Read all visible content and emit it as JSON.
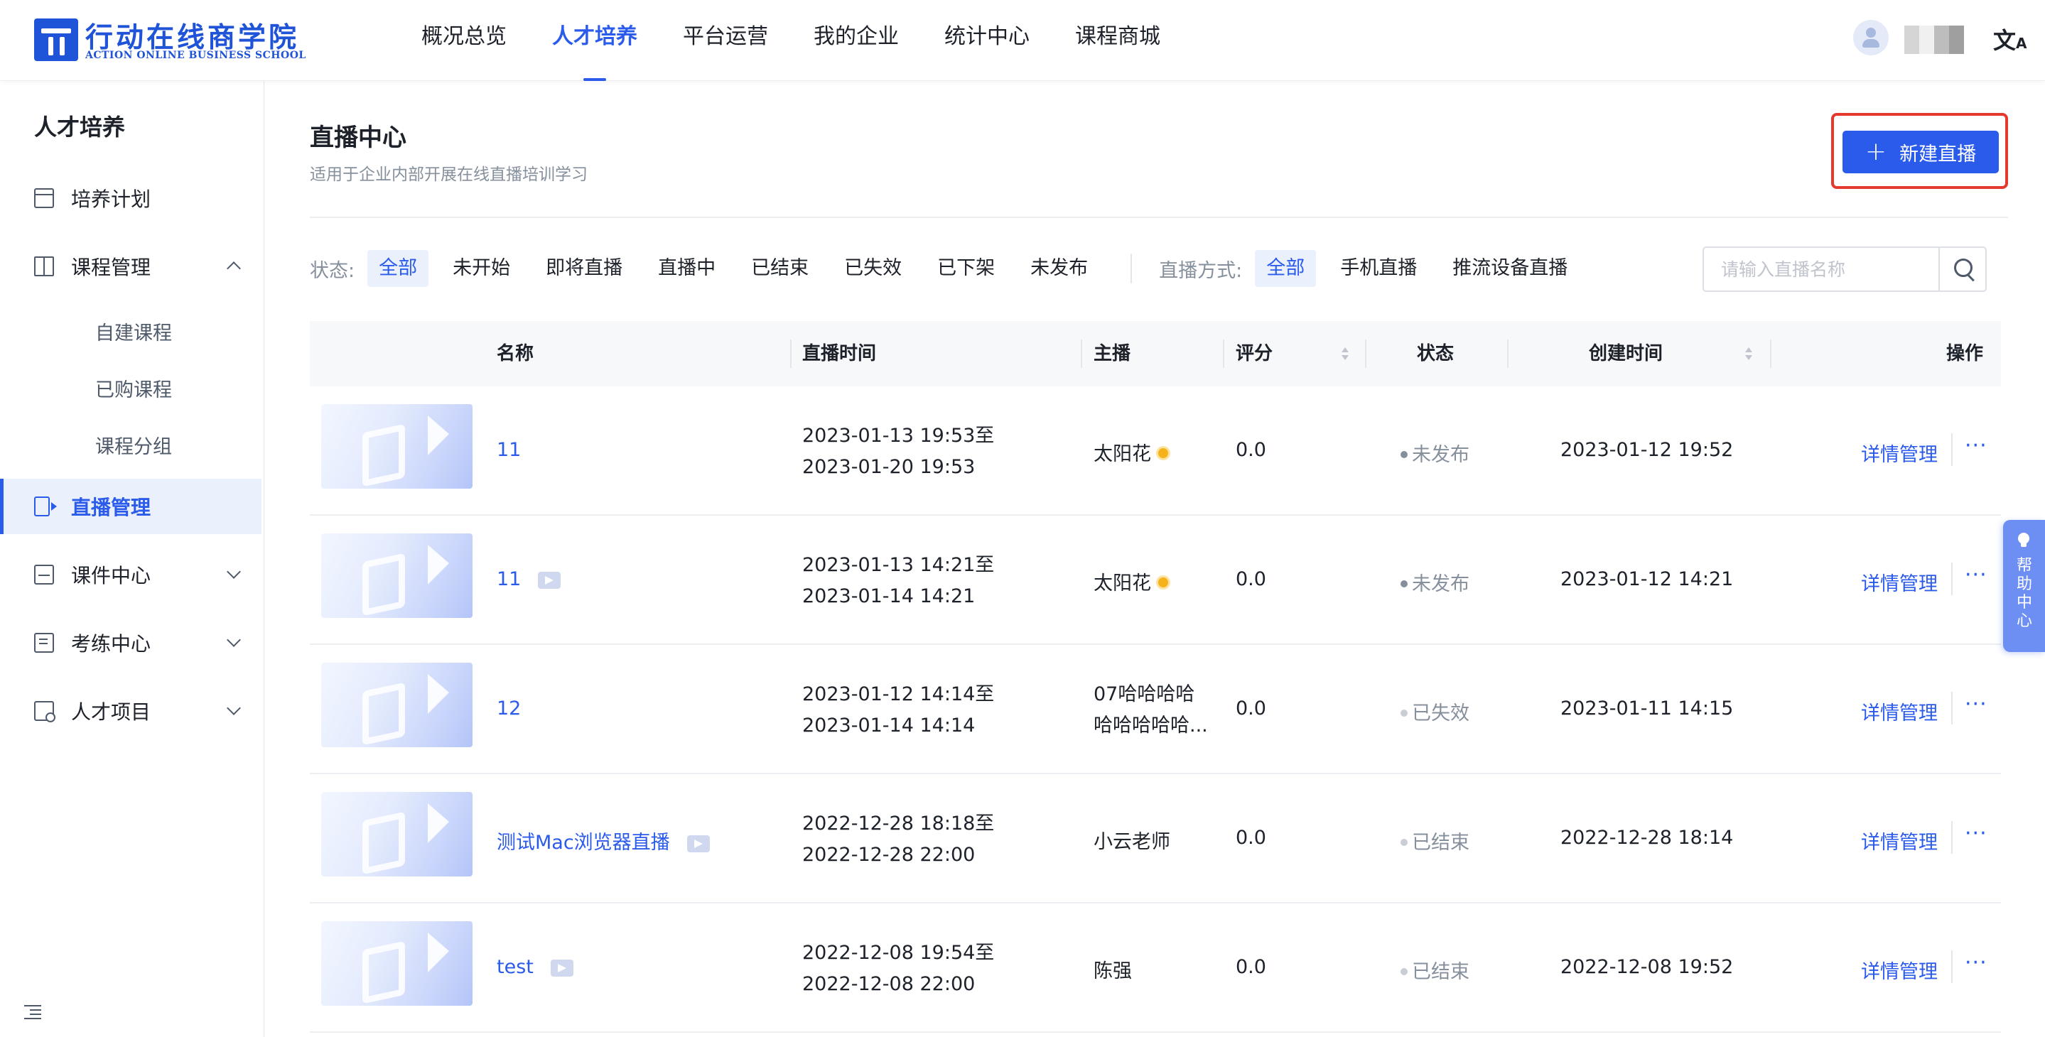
{
  "header": {
    "logo_cn": "行动在线商学院",
    "logo_en": "ACTION ONLINE BUSINESS SCHOOL",
    "nav": [
      {
        "label": "概况总览",
        "active": false
      },
      {
        "label": "人才培养",
        "active": true
      },
      {
        "label": "平台运营",
        "active": false
      },
      {
        "label": "我的企业",
        "active": false
      },
      {
        "label": "统计中心",
        "active": false
      },
      {
        "label": "课程商城",
        "active": false
      }
    ],
    "icons": {
      "avatar": "user-avatar-icon",
      "language": "translate-icon"
    }
  },
  "sidebar": {
    "title": "人才培养",
    "items": [
      {
        "label": "培养计划",
        "icon": "calendar-icon"
      },
      {
        "label": "课程管理",
        "icon": "book-icon",
        "expanded": true,
        "children": [
          "自建课程",
          "已购课程",
          "课程分组"
        ]
      },
      {
        "label": "直播管理",
        "icon": "live-video-icon",
        "active": true
      },
      {
        "label": "课件中心",
        "icon": "inbox-icon"
      },
      {
        "label": "考练中心",
        "icon": "exam-icon"
      },
      {
        "label": "人才项目",
        "icon": "project-icon"
      }
    ]
  },
  "page": {
    "title": "直播中心",
    "description": "适用于企业内部开展在线直播培训学习",
    "new_button": "新建直播",
    "accent_color": "#2b5bea",
    "highlight_color": "#e5392e"
  },
  "filters": {
    "status_label": "状态:",
    "status_options": [
      "全部",
      "未开始",
      "即将直播",
      "直播中",
      "已结束",
      "已失效",
      "已下架",
      "未发布"
    ],
    "status_active": "全部",
    "mode_label": "直播方式:",
    "mode_options": [
      "全部",
      "手机直播",
      "推流设备直播"
    ],
    "mode_active": "全部",
    "search_placeholder": "请输入直播名称"
  },
  "table": {
    "columns": [
      "名称",
      "直播时间",
      "主播",
      "评分",
      "状态",
      "创建时间",
      "操作"
    ],
    "rows": [
      {
        "name": "11",
        "has_live_icon": false,
        "time_start": "2023-01-13 19:53至",
        "time_end": "2023-01-20 19:53",
        "host": "太阳花",
        "host2": "",
        "host_emoji": true,
        "score": "0.0",
        "status": "未发布",
        "created": "2023-01-12 19:52",
        "action": "详情管理",
        "more": "···"
      },
      {
        "name": "11",
        "has_live_icon": true,
        "time_start": "2023-01-13 14:21至",
        "time_end": "2023-01-14 14:21",
        "host": "太阳花",
        "host2": "",
        "host_emoji": true,
        "score": "0.0",
        "status": "未发布",
        "created": "2023-01-12 14:21",
        "action": "详情管理",
        "more": "···"
      },
      {
        "name": "12",
        "has_live_icon": false,
        "time_start": "2023-01-12 14:14至",
        "time_end": "2023-01-14 14:14",
        "host": "07哈哈哈哈",
        "host2": "哈哈哈哈哈...",
        "host_emoji": false,
        "score": "0.0",
        "status": "已失效",
        "created": "2023-01-11 14:15",
        "action": "详情管理",
        "more": "···"
      },
      {
        "name": "测试Mac浏览器直播",
        "has_live_icon": true,
        "time_start": "2022-12-28 18:18至",
        "time_end": "2022-12-28 22:00",
        "host": "小云老师",
        "host2": "",
        "host_emoji": false,
        "score": "0.0",
        "status": "已结束",
        "created": "2022-12-28 18:14",
        "action": "详情管理",
        "more": "···"
      },
      {
        "name": "test",
        "has_live_icon": true,
        "time_start": "2022-12-08 19:54至",
        "time_end": "2022-12-08 22:00",
        "host": "陈强",
        "host2": "",
        "host_emoji": false,
        "score": "0.0",
        "status": "已结束",
        "created": "2022-12-08 19:52",
        "action": "详情管理",
        "more": "···"
      }
    ],
    "status_colors": {
      "未发布": "#86909c",
      "已失效": "#c9cdd4",
      "已结束": "#c9cdd4"
    }
  },
  "help": {
    "label": "帮助中心"
  }
}
